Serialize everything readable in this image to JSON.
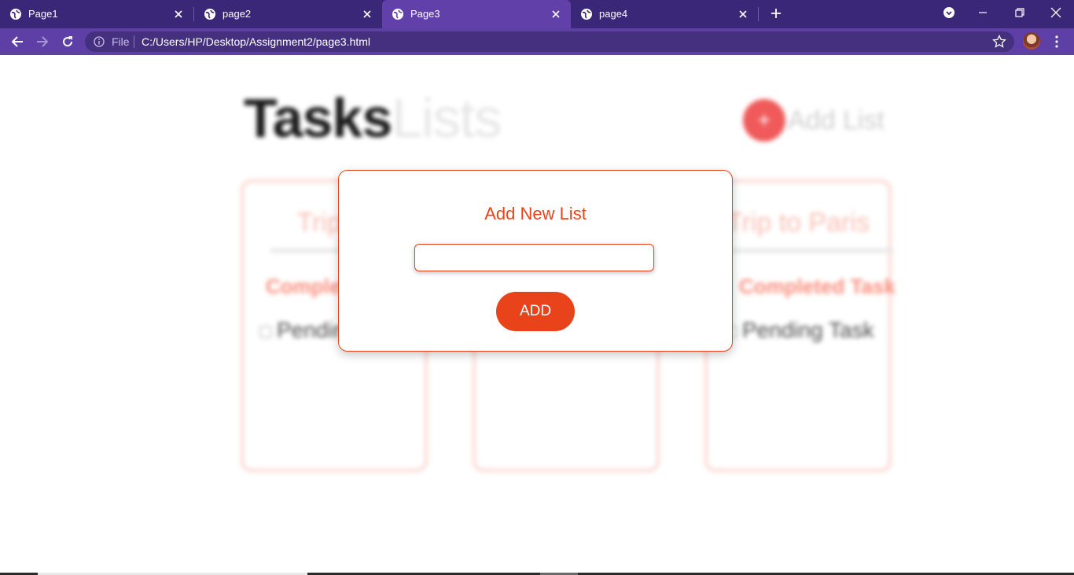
{
  "browser": {
    "tabs": [
      {
        "title": "Page1",
        "active": false
      },
      {
        "title": "page2",
        "active": false
      },
      {
        "title": "Page3",
        "active": true
      },
      {
        "title": "page4",
        "active": false
      }
    ],
    "address": {
      "scheme_label": "File",
      "url": "C:/Users/HP/Desktop/Assignment2/page3.html"
    },
    "colors": {
      "tabstrip": "#3b2777",
      "active_tab": "#6140a9",
      "toolbar": "#5e3fa6"
    }
  },
  "page": {
    "heading_bold": "Tasks",
    "heading_light": "Lists",
    "add_list_button_symbol": "+",
    "add_list_label": "Add List",
    "lists": [
      {
        "title": "Trip to",
        "completed_label": "Completed",
        "pending_label": "Pending"
      },
      {
        "title": "",
        "completed_label": "",
        "pending_label": ""
      },
      {
        "title": "Trip to Paris",
        "completed_label": "Completed Task",
        "pending_label": "Pending Task"
      }
    ]
  },
  "modal": {
    "title": "Add New List",
    "input_value": "",
    "input_placeholder": "",
    "add_button_label": "ADD",
    "accent_color": "#e8431b"
  }
}
